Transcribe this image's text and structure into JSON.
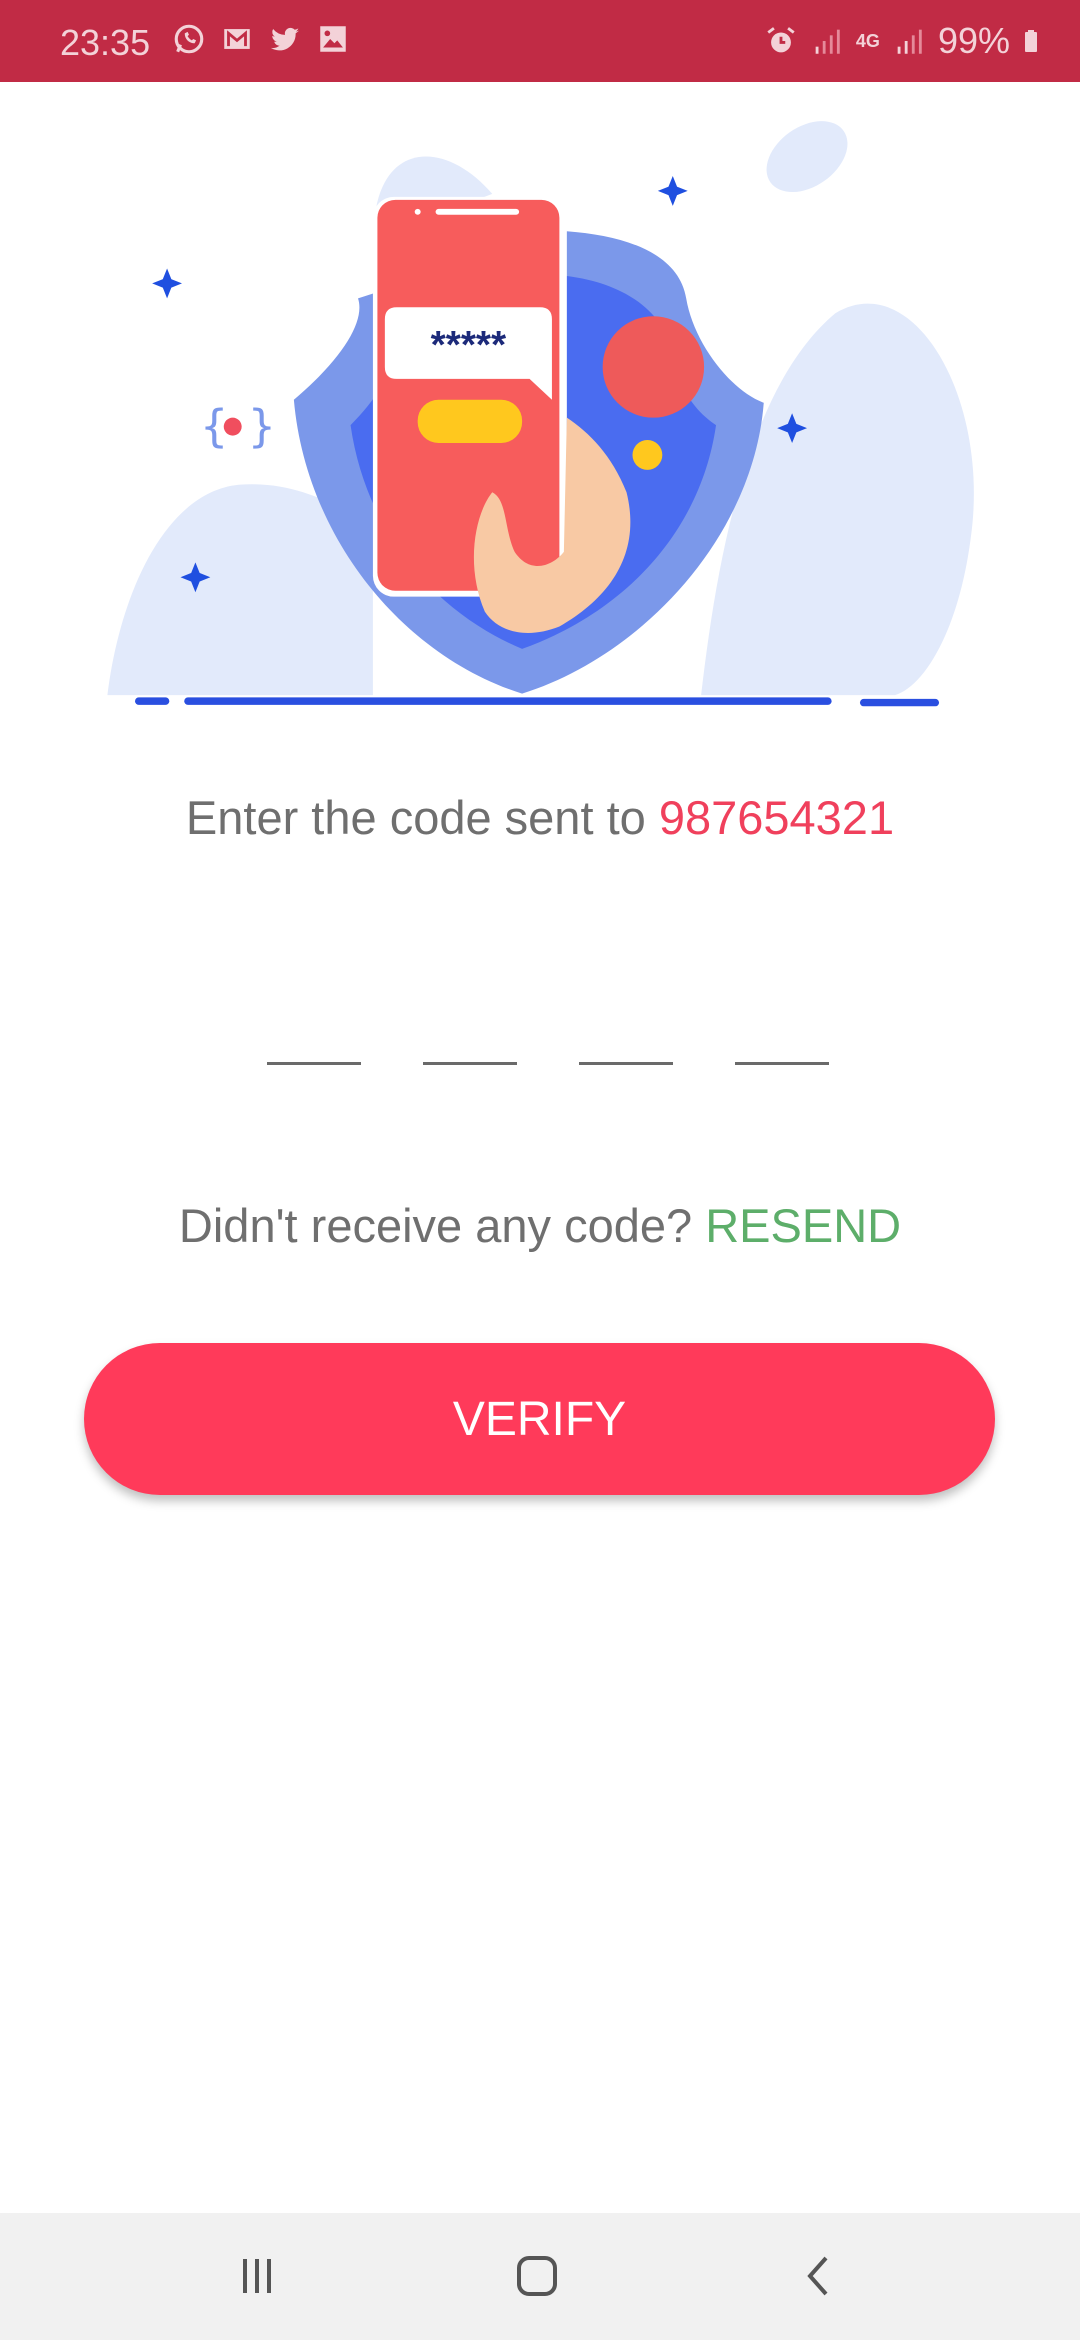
{
  "status_bar": {
    "time": "23:35",
    "notification_icons": [
      "whatsapp-icon",
      "gmail-icon",
      "twitter-icon",
      "gallery-icon"
    ],
    "network": "4G",
    "battery": "99%",
    "background": "#C12B45"
  },
  "illustration": {
    "bubble_text": "*****"
  },
  "prompt": {
    "text": "Enter the code sent to ",
    "phone_number": "987654321"
  },
  "otp": {
    "digits": [
      "",
      "",
      "",
      ""
    ]
  },
  "resend": {
    "text": "Didn't receive any code? ",
    "link_label": "RESEND"
  },
  "verify_button": {
    "label": "VERIFY",
    "color": "#FF3A5A"
  },
  "nav_bar": {
    "buttons": [
      "recent-apps-icon",
      "home-icon",
      "back-icon"
    ]
  }
}
